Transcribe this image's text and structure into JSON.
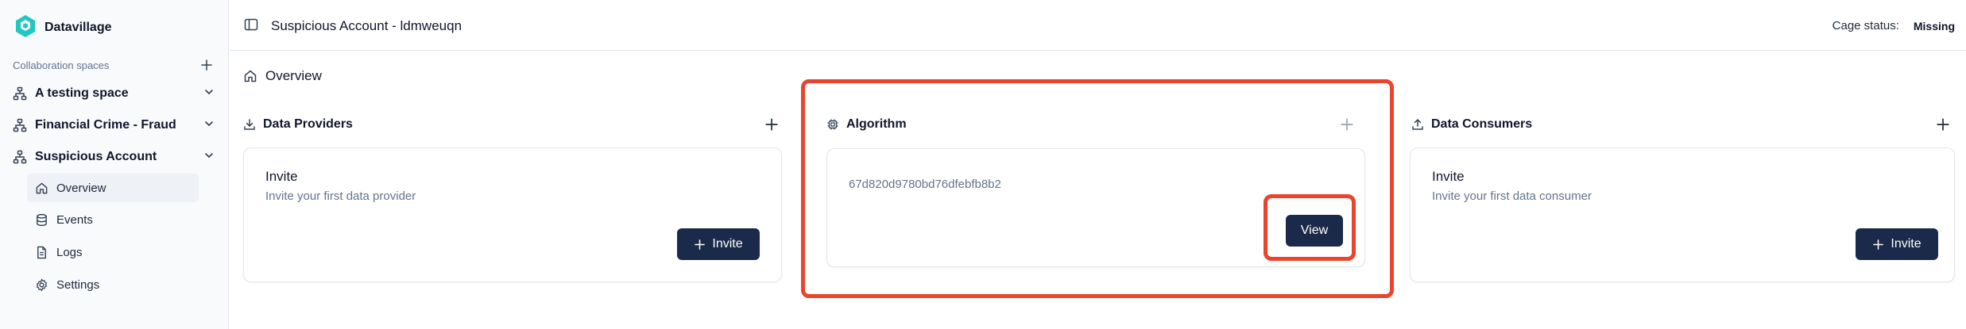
{
  "app": {
    "brand_name": "Datavillage",
    "accent": "#22c7c0",
    "primary_button": "#1b2a4a",
    "highlight_color": "#e8452c"
  },
  "sidebar": {
    "section_label": "Collaboration spaces",
    "spaces": [
      {
        "name": "A testing space",
        "icon": "network-icon",
        "expanded": false
      },
      {
        "name": "Financial Crime - Fraud",
        "icon": "network-icon",
        "expanded": false
      },
      {
        "name": "Suspicious Account",
        "icon": "network-icon",
        "expanded": true
      }
    ],
    "sub_items": [
      {
        "label": "Overview",
        "icon": "home-icon",
        "active": true
      },
      {
        "label": "Events",
        "icon": "database-icon",
        "active": false
      },
      {
        "label": "Logs",
        "icon": "file-icon",
        "active": false
      },
      {
        "label": "Settings",
        "icon": "gear-icon",
        "active": false
      }
    ]
  },
  "header": {
    "title": "Suspicious Account - ldmweuqn",
    "cage_label": "Cage status:",
    "cage_value": "Missing"
  },
  "main": {
    "overview_title": "Overview",
    "data_providers": {
      "title": "Data Providers",
      "card_title": "Invite",
      "card_subtitle": "Invite your first data provider",
      "button_label": "Invite"
    },
    "algorithm": {
      "title": "Algorithm",
      "hash": "67d820d9780bd76dfebfb8b2",
      "button_label": "View"
    },
    "data_consumers": {
      "title": "Data Consumers",
      "card_title": "Invite",
      "card_subtitle": "Invite your first data consumer",
      "button_label": "Invite"
    }
  }
}
